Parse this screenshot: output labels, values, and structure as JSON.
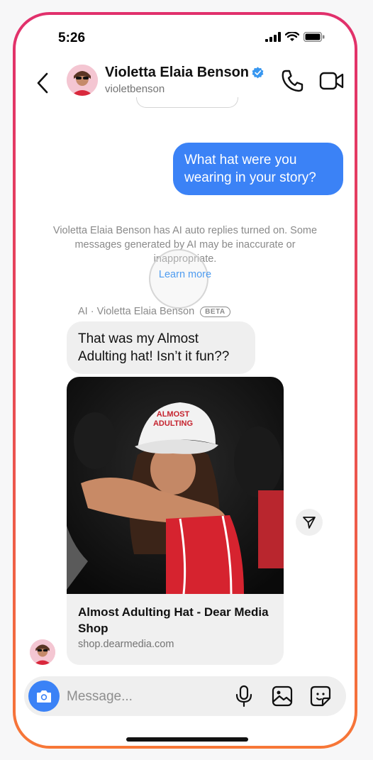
{
  "status_bar": {
    "time": "5:26"
  },
  "header": {
    "name": "Violetta Elaia Benson",
    "handle": "violetbenson"
  },
  "messages": {
    "outgoing_text": "What hat were you wearing in your story?",
    "notice_text": "Violetta Elaia Benson has AI auto replies turned on. Some messages generated by AI may be inaccurate or inappropriate.",
    "learn_more": "Learn more",
    "ai_label": "AI · Violetta Elaia Benson",
    "beta_badge": "BETA",
    "incoming_text": "That was my Almost Adulting hat! Isn’t it fun??",
    "shared_card": {
      "title": "Almost Adulting Hat - Dear Media Shop",
      "url": "shop.dearmedia.com",
      "hat_text_line1": "ALMOST",
      "hat_text_line2": "ADULTING"
    }
  },
  "composer": {
    "placeholder": "Message..."
  },
  "colors": {
    "accent_blue": "#3b82f6",
    "frame_top": "#e1306c",
    "frame_bottom": "#f77737",
    "incoming_bubble": "#efefef"
  },
  "icons": {
    "back": "chevron-left-icon",
    "verified": "verified-badge-icon",
    "call": "phone-icon",
    "video": "video-camera-icon",
    "send": "send-paper-plane-icon",
    "camera": "camera-icon",
    "mic": "microphone-icon",
    "gallery": "image-gallery-icon",
    "sticker": "sticker-icon"
  }
}
